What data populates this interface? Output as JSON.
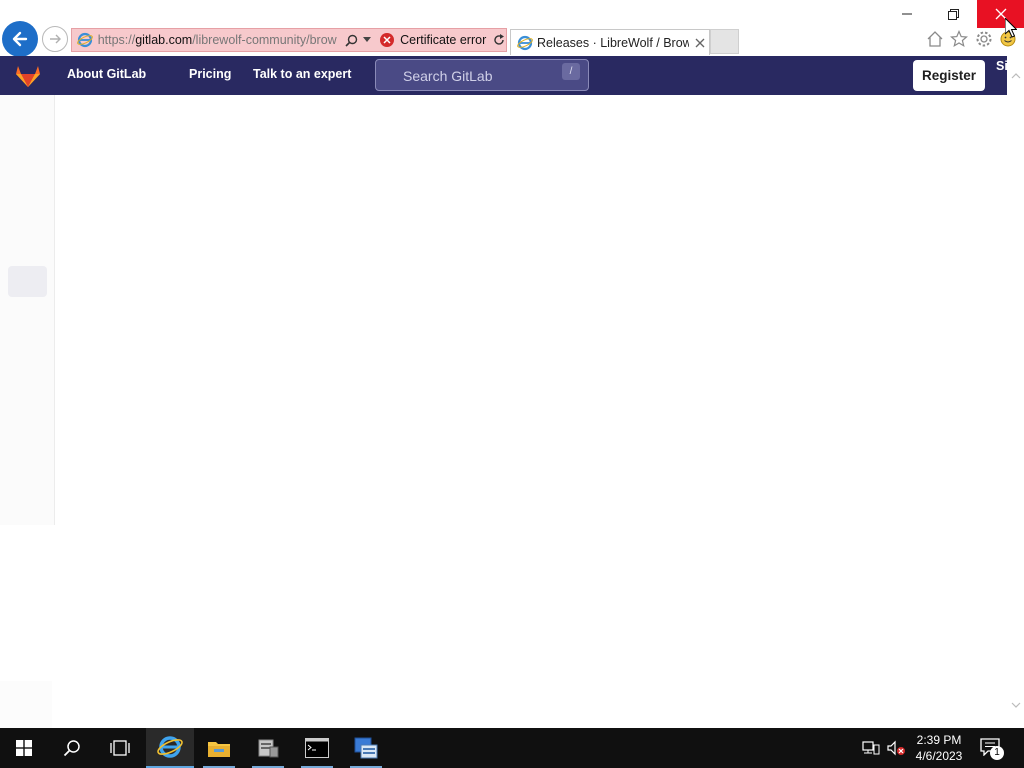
{
  "browser": {
    "address": {
      "url_prefix": "https://",
      "url_host": "gitlab.com",
      "url_path": "/librewolf-community/brow",
      "certificate_text": "Certificate error"
    },
    "tab": {
      "title": "Releases · LibreWolf / Brow..."
    }
  },
  "gitlab": {
    "nav": {
      "about": "About GitLab",
      "pricing": "Pricing",
      "expert": "Talk to an expert",
      "search_placeholder": "Search GitLab",
      "search_shortcut": "/",
      "register": "Register",
      "signin": "Sign in"
    }
  },
  "taskbar": {
    "time": "2:39 PM",
    "date": "4/6/2023",
    "notification_count": "1"
  },
  "colors": {
    "gitlab_nav": "#292961",
    "close_button": "#e81123",
    "address_error": "#f7c9cc",
    "taskbar": "#101010"
  },
  "icons": [
    "back-arrow-icon",
    "forward-arrow-icon",
    "ie-icon",
    "search-icon",
    "certificate-error-icon",
    "refresh-icon",
    "close-icon",
    "home-icon",
    "star-icon",
    "gear-icon",
    "smiley-icon",
    "gitlab-logo",
    "windows-start-icon",
    "taskview-icon",
    "folder-icon",
    "server-manager-icon",
    "command-prompt-icon",
    "network-icon",
    "volume-muted-icon",
    "notification-icon"
  ]
}
